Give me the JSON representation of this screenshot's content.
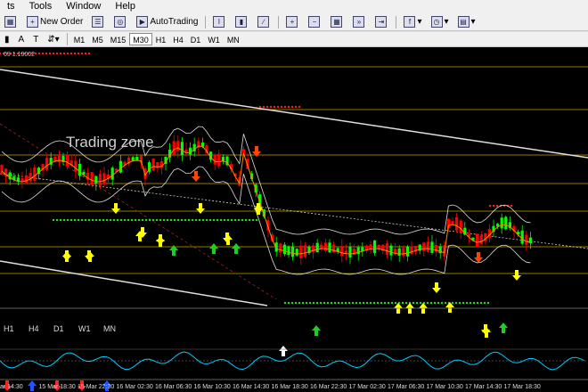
{
  "menu": {
    "items": [
      "ts",
      "Tools",
      "Window",
      "Help"
    ]
  },
  "toolbar": {
    "new_order_label": "New Order",
    "autotrading_label": "AutoTrading",
    "font_button_label": "A",
    "text_button_label": "T"
  },
  "timeframes": {
    "items": [
      "M1",
      "M5",
      "M15",
      "M30",
      "H1",
      "H4",
      "D1",
      "W1",
      "MN"
    ],
    "active": "M30"
  },
  "chart": {
    "symbol_info": "69 1.19002",
    "annotation": "Trading zone",
    "time_labels": [
      "ar 14:30",
      "15 Mar 18:30",
      "15 Mar 22:30",
      "16 Mar 02:30",
      "16 Mar 06:30",
      "16 Mar 10:30",
      "16 Mar 14:30",
      "16 Mar 18:30",
      "16 Mar 22:30",
      "17 Mar 02:30",
      "17 Mar 06:30",
      "17 Mar 10:30",
      "17 Mar 14:30",
      "17 Mar 18:30"
    ],
    "colors": {
      "background": "#000000",
      "bull": "#00ff00",
      "bear": "#ff0000",
      "level": "#c8a000",
      "arrow_up": "#ffff00",
      "arrow_down": "#ff4400"
    }
  },
  "mtf": {
    "items": [
      {
        "label": "H1",
        "dir": "down"
      },
      {
        "label": "H4",
        "dir": "up"
      },
      {
        "label": "D1",
        "dir": "down"
      },
      {
        "label": "W1",
        "dir": "down"
      },
      {
        "label": "MN",
        "dir": "up"
      }
    ]
  }
}
